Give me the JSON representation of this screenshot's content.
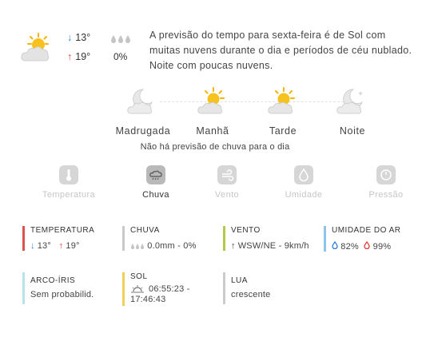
{
  "summary": {
    "icon": "sun-behind-cloud-icon",
    "temp_min": "13°",
    "temp_max": "19°",
    "rain_icon": "rain-drops-icon",
    "rain_prob": "0%",
    "description": "A previsão do tempo para sexta-feira é de Sol com muitas nuvens durante o dia e períodos de céu nublado. Noite com poucas nuvens."
  },
  "periods": [
    {
      "label": "Madrugada",
      "icon": "moon-cloud-icon"
    },
    {
      "label": "Manhã",
      "icon": "sun-cloud-icon"
    },
    {
      "label": "Tarde",
      "icon": "sun-cloud-icon"
    },
    {
      "label": "Noite",
      "icon": "moon-cloud-icon"
    }
  ],
  "no_rain_text": "Não há previsão de chuva para o dia",
  "tabs": [
    {
      "label": "Temperatura",
      "icon": "thermometer-icon",
      "active": false
    },
    {
      "label": "Chuva",
      "icon": "rain-cloud-icon",
      "active": true
    },
    {
      "label": "Vento",
      "icon": "wind-icon",
      "active": false
    },
    {
      "label": "Umidade",
      "icon": "drop-icon",
      "active": false
    },
    {
      "label": "Pressão",
      "icon": "gauge-icon",
      "active": false
    }
  ],
  "stats": {
    "temperature": {
      "title": "TEMPERATURA",
      "min": "13°",
      "max": "19°",
      "color": "#d9534f"
    },
    "rain": {
      "title": "CHUVA",
      "value": "0.0mm - 0%",
      "color": "#c9c9c9"
    },
    "wind": {
      "title": "VENTO",
      "value": "WSW/NE - 9km/h",
      "color": "#b5c84a"
    },
    "humidity": {
      "title": "UMIDADE DO AR",
      "min": "82%",
      "max": "99%",
      "color": "#8fc4ea"
    },
    "rainbow": {
      "title": "ARCO-ÍRIS",
      "value": "Sem probabilid.",
      "color": "#b8e3e8"
    },
    "sun": {
      "title": "SOL",
      "value": "06:55:23 - 17:46:43",
      "color": "#f2cf59"
    },
    "moon": {
      "title": "LUA",
      "value": "crescente",
      "color": "#cccccc"
    }
  }
}
